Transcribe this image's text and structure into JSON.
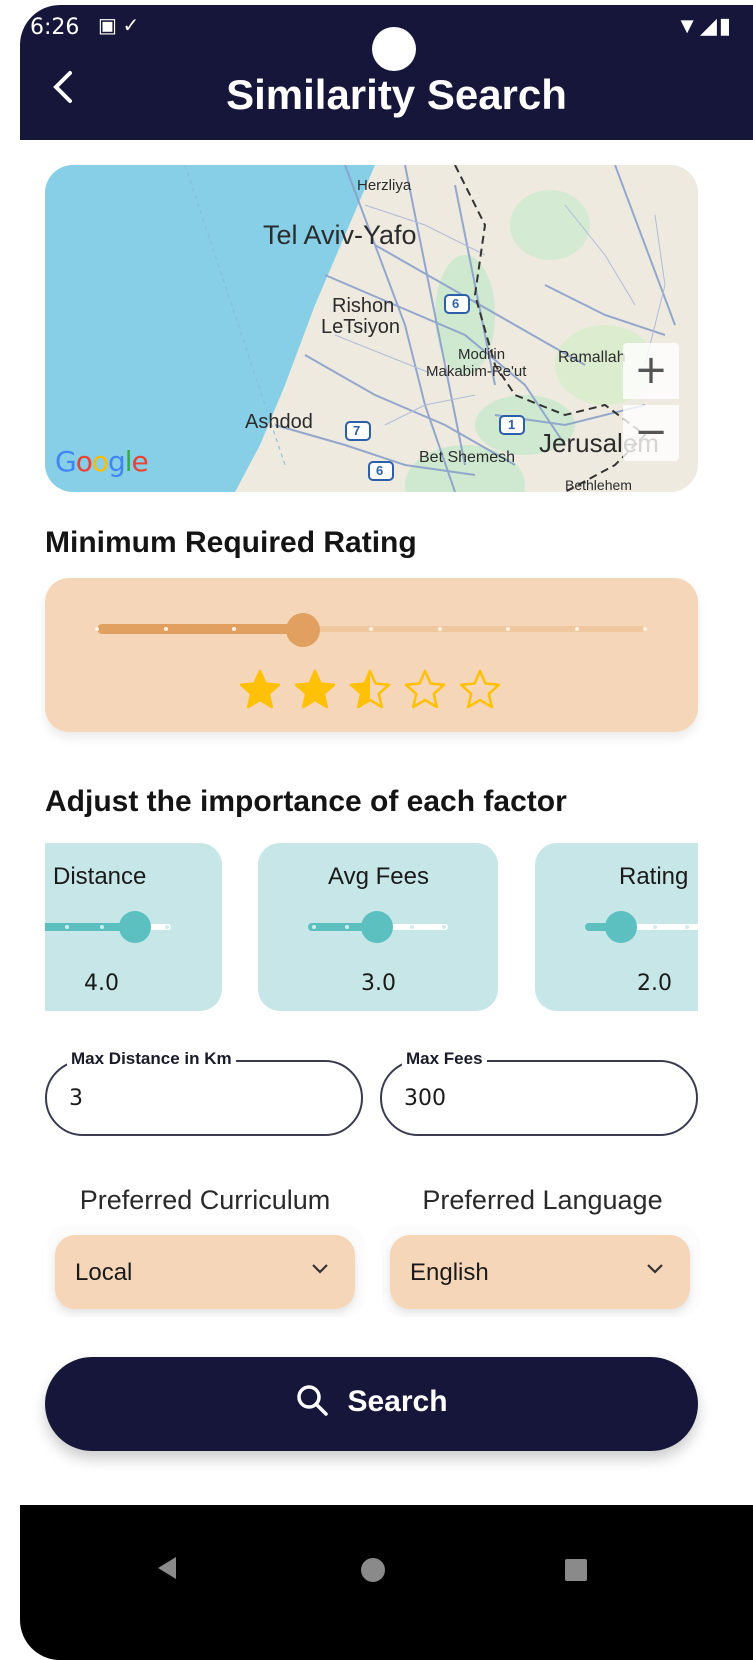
{
  "status": {
    "time": "6:26",
    "icons_left": "▣ ✓",
    "icons_right": "▼◢▮"
  },
  "header": {
    "title": "Similarity Search",
    "back_icon": "chevron-left-icon"
  },
  "map": {
    "labels": {
      "herzliya": "Herzliya",
      "tel_aviv": "Tel Aviv-Yafo",
      "rishon_1": "Rishon",
      "rishon_2": "LeTsiyon",
      "modiin_1": "Modi'in",
      "modiin_2": "Makabim-Re'ut",
      "ramallah": "Ramallah",
      "ashdod": "Ashdod",
      "bet_shemesh": "Bet Shemesh",
      "jerusalem": "Jerusalem",
      "bethlehem": "Bethlehem"
    },
    "road_shields": {
      "r6a": "6",
      "r7": "7",
      "r1": "1",
      "r6b": "6"
    },
    "zoom_in": "+",
    "zoom_out": "−",
    "attribution": "Google"
  },
  "rating": {
    "title": "Minimum Required Rating",
    "slider_fraction": 0.375,
    "stars_value": 2.5,
    "stars_max": 5,
    "colors": {
      "fill": "#e2a060",
      "star": "#ffc107"
    }
  },
  "factors": {
    "title": "Adjust the importance of each factor",
    "items": [
      {
        "label": "Distance",
        "value": "4.0"
      },
      {
        "label": "Avg Fees",
        "value": "3.0"
      },
      {
        "label": "Rating",
        "value": "2.0"
      }
    ]
  },
  "fields": {
    "distance": {
      "label": "Max Distance in Km",
      "value": "3"
    },
    "fees": {
      "label": "Max Fees",
      "value": "300"
    }
  },
  "prefs": {
    "curriculum": {
      "label": "Preferred Curriculum",
      "value": "Local"
    },
    "language": {
      "label": "Preferred Language",
      "value": "English"
    }
  },
  "search": {
    "label": "Search",
    "icon": "search-icon"
  },
  "colors": {
    "primary": "#16163a",
    "peach": "#f6d6b8",
    "teal": "#5cc0c0",
    "teal_card": "#c7e6e7"
  }
}
